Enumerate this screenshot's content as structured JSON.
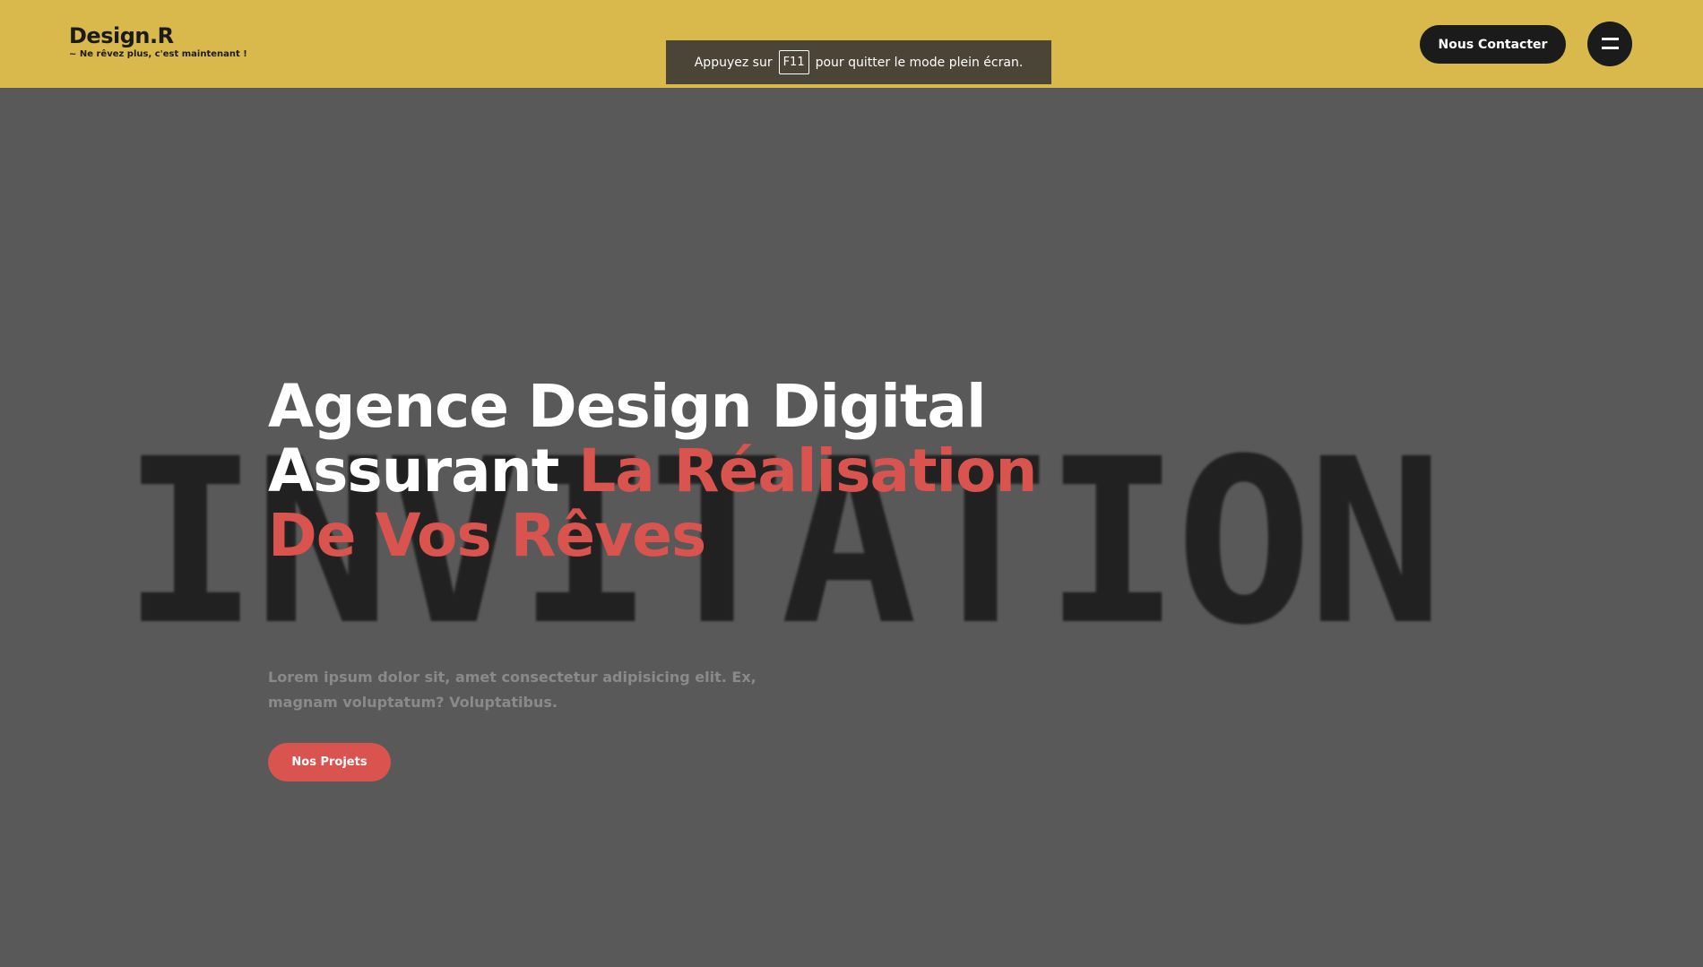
{
  "header": {
    "logo_title": "Design.R",
    "logo_tagline": "~ Ne rêvez plus, c'est maintenant !",
    "contact_label": "Nous Contacter",
    "menu_icon": "hamburger-icon",
    "background_color": "#d9b94c"
  },
  "fullscreen_notice": {
    "prefix": "Appuyez sur",
    "key": "F11",
    "suffix": "pour quitter le mode plein écran."
  },
  "hero": {
    "background_word": "INVITATION",
    "headline_white": "Agence Design Digital Assurant ",
    "headline_accent": "La Réalisation De Vos Rêves",
    "lead": "Lorem ipsum dolor sit, amet consectetur adipisicing elit. Ex, magnam voluptatum? Voluptatibus.",
    "cta_label": "Nos Projets",
    "accent_color": "#d9534f",
    "background_color": "#595959"
  }
}
